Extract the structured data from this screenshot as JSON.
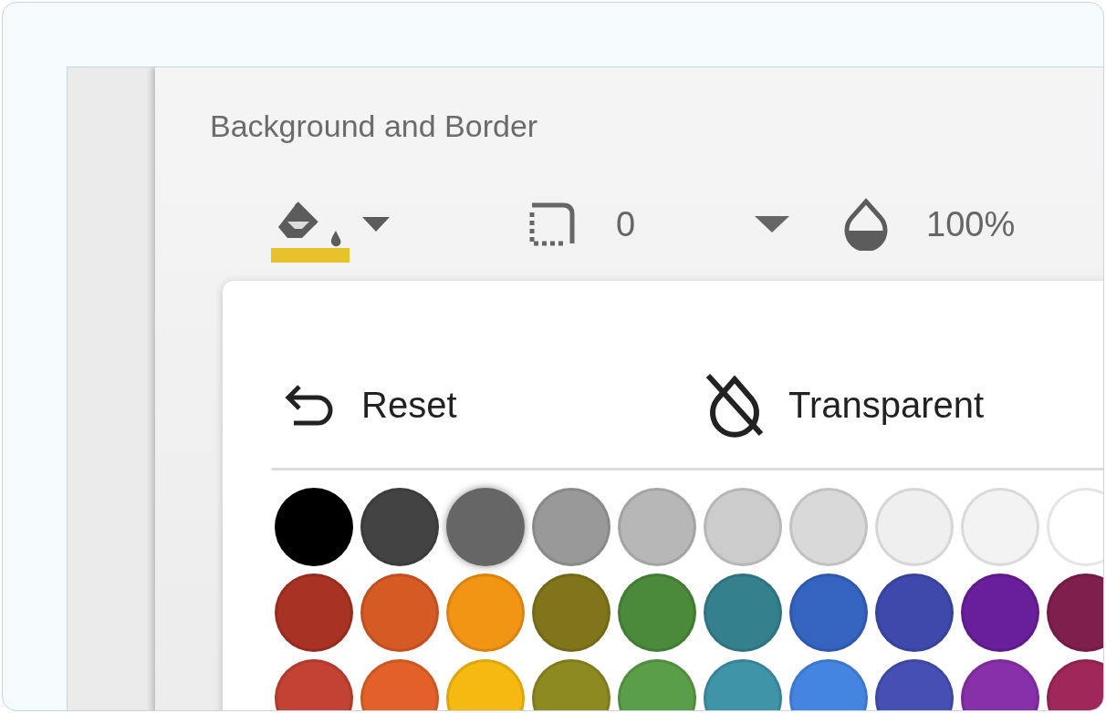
{
  "panel": {
    "title": "Background and Border"
  },
  "toolbar": {
    "border_radius": "0",
    "opacity": "100%"
  },
  "color_popup": {
    "actions": [
      {
        "kind": "reset",
        "label": "Reset"
      },
      {
        "kind": "transparent",
        "label": "Transparent"
      }
    ],
    "swatch_rows": [
      [
        {
          "color": "#000000",
          "selected": false
        },
        {
          "color": "#434343",
          "selected": false
        },
        {
          "color": "#666666",
          "selected": true
        },
        {
          "color": "#999999",
          "selected": false
        },
        {
          "color": "#b7b7b7",
          "selected": false
        },
        {
          "color": "#cccccc",
          "selected": false
        },
        {
          "color": "#d9d9d9",
          "selected": false
        },
        {
          "color": "#efefef",
          "selected": false
        },
        {
          "color": "#f3f3f3",
          "selected": false
        },
        {
          "color": "#ffffff",
          "selected": false
        }
      ],
      [
        {
          "color": "#a83224",
          "selected": false
        },
        {
          "color": "#d65a24",
          "selected": false
        },
        {
          "color": "#f29414",
          "selected": false
        },
        {
          "color": "#80751b",
          "selected": false
        },
        {
          "color": "#4a8a3a",
          "selected": false
        },
        {
          "color": "#35808d",
          "selected": false
        },
        {
          "color": "#3464bf",
          "selected": false
        },
        {
          "color": "#3e4aab",
          "selected": false
        },
        {
          "color": "#6a1f9a",
          "selected": false
        },
        {
          "color": "#7e1f4d",
          "selected": false
        }
      ],
      [
        {
          "color": "#c44233",
          "selected": false
        },
        {
          "color": "#e36128",
          "selected": false
        },
        {
          "color": "#f5b90f",
          "selected": false
        },
        {
          "color": "#8e8a22",
          "selected": false
        },
        {
          "color": "#5a9e48",
          "selected": false
        },
        {
          "color": "#3f94a8",
          "selected": false
        },
        {
          "color": "#4585e2",
          "selected": false
        },
        {
          "color": "#4650b4",
          "selected": false
        },
        {
          "color": "#8830aa",
          "selected": false
        },
        {
          "color": "#a0275a",
          "selected": false
        }
      ]
    ]
  }
}
